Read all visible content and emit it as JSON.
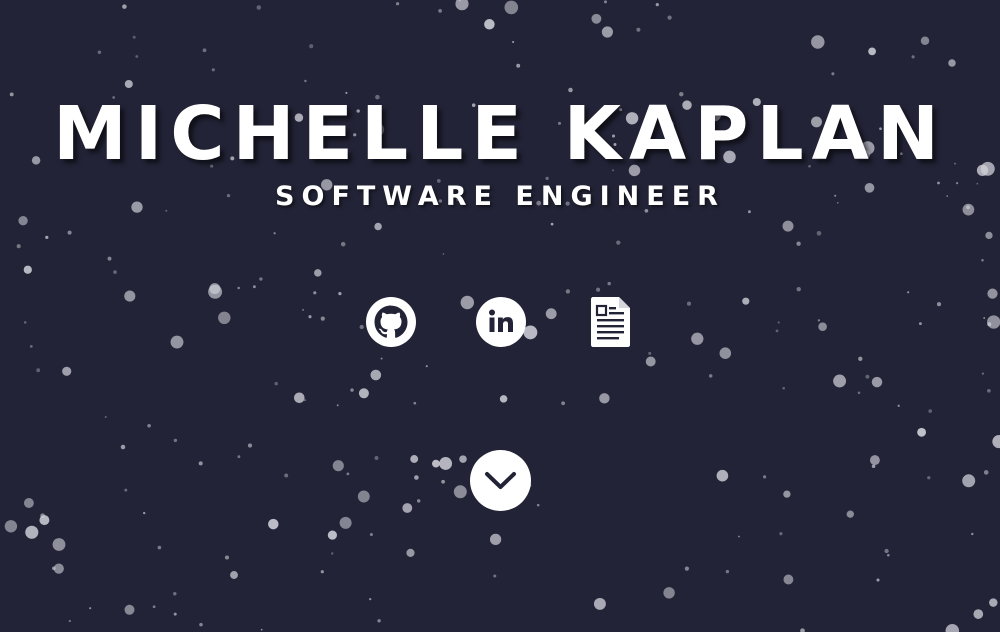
{
  "hero": {
    "name": "MICHELLE KAPLAN",
    "title": "SOFTWARE ENGINEER",
    "background_color": "#222336",
    "text_color": "#ffffff",
    "particle_color": "#cfd0d8"
  },
  "links": [
    {
      "icon": "github-icon"
    },
    {
      "icon": "linkedin-icon"
    },
    {
      "icon": "resume-document-icon"
    }
  ],
  "scroll_button": {
    "icon": "chevron-down-icon"
  }
}
